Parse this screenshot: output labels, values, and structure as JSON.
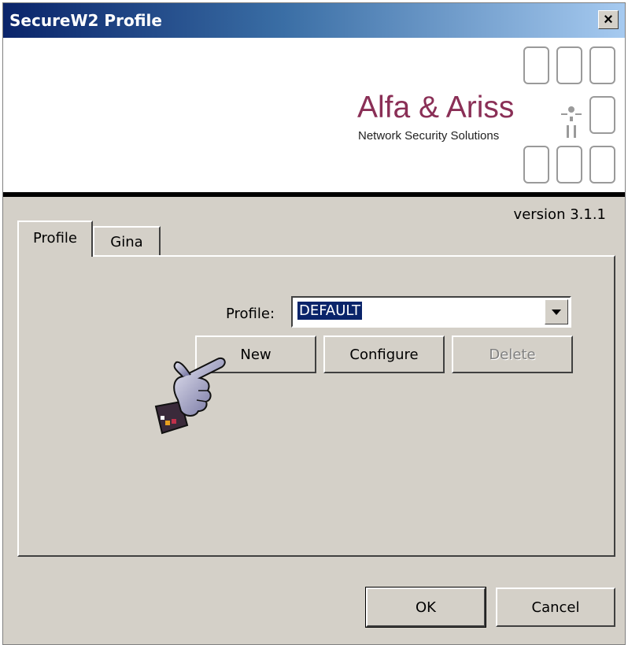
{
  "window": {
    "title": "SecureW2 Profile",
    "close_label": "×"
  },
  "banner": {
    "brand_name": "Alfa & Ariss",
    "brand_subtitle": "Network Security Solutions",
    "colors": {
      "brand": "#8a2f56",
      "logo_boxes": "#9a9a9a"
    }
  },
  "version_text": "version 3.1.1",
  "tabs": [
    {
      "label": "Profile",
      "active": true
    },
    {
      "label": "Gina",
      "active": false
    }
  ],
  "profile_tab": {
    "profile_label": "Profile:",
    "profile_value": "DEFAULT",
    "buttons": {
      "new": "New",
      "configure": "Configure",
      "delete": "Delete"
    },
    "pointer_icon": "pointing-hand-icon"
  },
  "footer": {
    "ok": "OK",
    "cancel": "Cancel"
  },
  "colors": {
    "dialog_bg": "#d4d0c8",
    "title_gradient_start": "#0a246a",
    "title_gradient_end": "#a6caf0",
    "selection": "#0a246a"
  }
}
